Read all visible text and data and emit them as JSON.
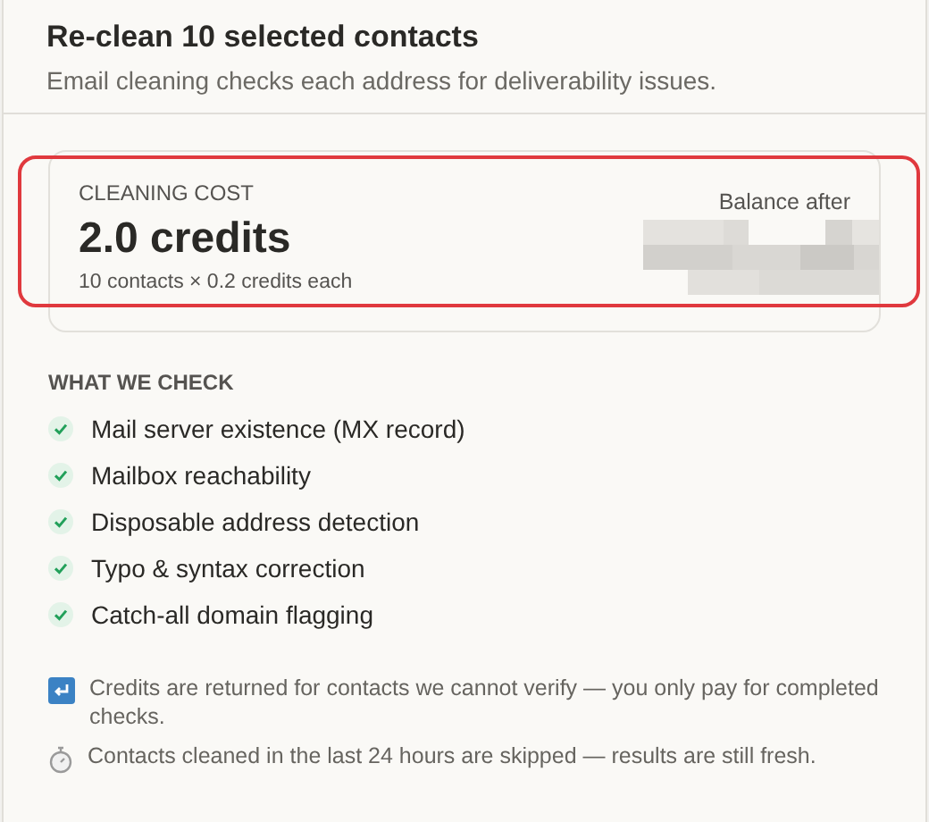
{
  "header": {
    "title": "Re-clean 10 selected contacts",
    "subtitle": "Email cleaning checks each address for deliverability issues."
  },
  "cost_card": {
    "label": "CLEANING COST",
    "amount": "2.0 credits",
    "breakdown": "10 contacts × 0.2 credits each",
    "balance_label": "Balance after",
    "highlighted": true
  },
  "checks": {
    "heading": "WHAT WE CHECK",
    "items": [
      {
        "label": "Mail server existence (MX record)",
        "checked": true
      },
      {
        "label": "Mailbox reachability",
        "checked": true
      },
      {
        "label": "Disposable address detection",
        "checked": true
      },
      {
        "label": "Typo & syntax correction",
        "checked": true
      },
      {
        "label": "Catch-all domain flagging",
        "checked": true
      }
    ]
  },
  "notes": [
    {
      "kind": "return",
      "text": "Credits are returned for contacts we cannot verify — you only pay for completed checks."
    },
    {
      "kind": "stopwatch",
      "text": "Contacts cleaned in the last 24 hours are skipped — results are still fresh."
    }
  ]
}
